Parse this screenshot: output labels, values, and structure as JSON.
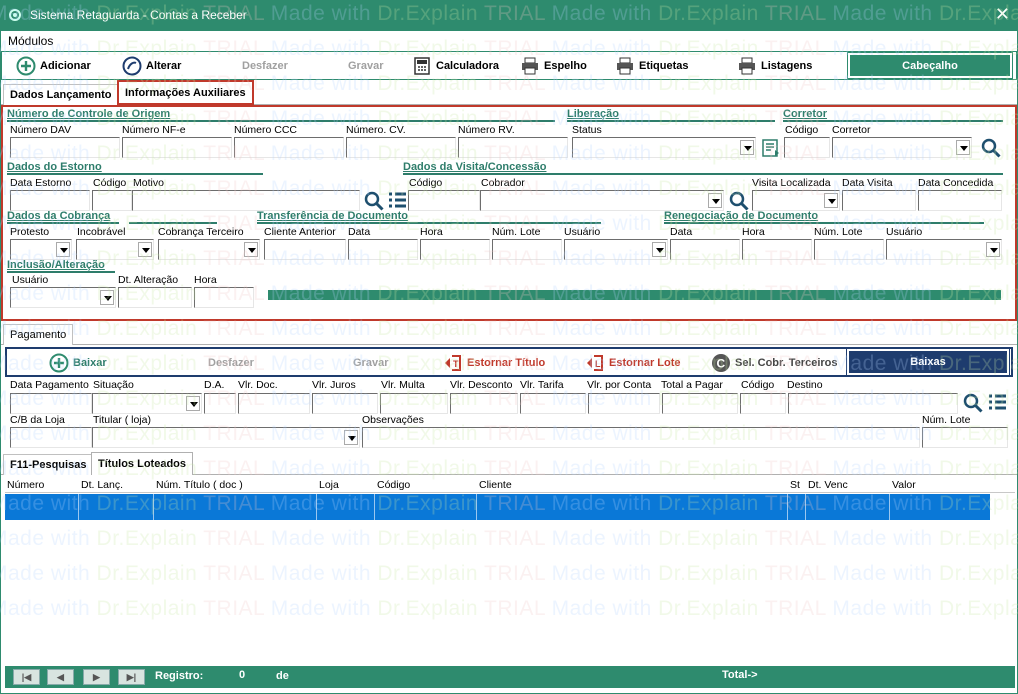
{
  "window": {
    "title": "Sistema Retaguarda - Contas a Receber",
    "close_glyph": "✕"
  },
  "menu": {
    "items": [
      "Módulos"
    ]
  },
  "toolbar1": {
    "adicionar": "Adicionar",
    "alterar": "Alterar",
    "desfazer": "Desfazer",
    "gravar": "Gravar",
    "calculadora": "Calculadora",
    "espelho": "Espelho",
    "etiquetas": "Etiquetas",
    "listagens": "Listagens",
    "cabecalho": "Cabeçalho"
  },
  "tabs_top": {
    "dados": "Dados Lançamento",
    "info": "Informações Auxiliares"
  },
  "sections": {
    "controle": "Número de Controle de Origem",
    "liberacao": "Liberação",
    "corretor": "Corretor",
    "estorno": "Dados do Estorno",
    "visita": "Dados da Visita/Concessão",
    "cobranca": "Dados da Cobrança",
    "transferencia": "Transferência de Documento",
    "renegociacao": "Renegociação de Documento",
    "inclusao": "Inclusão/Alteração"
  },
  "labels": {
    "numero_dav": "Número DAV",
    "numero_nfe": "Número NF-e",
    "numero_ccc": "Número CCC",
    "numero_cv": "Número. CV.",
    "numero_rv": "Número RV.",
    "status": "Status",
    "codigo": "Código",
    "corretor": "Corretor",
    "data_estorno": "Data Estorno",
    "motivo": "Motivo",
    "cobrador": "Cobrador",
    "visita_localizada": "Visita Localizada",
    "data_visita": "Data Visita",
    "data_concedida": "Data Concedida",
    "protesto": "Protesto",
    "incobravel": "Incobrável",
    "cobranca_terceiro": "Cobrança Terceiro",
    "cliente_anterior": "Cliente Anterior",
    "data": "Data",
    "hora": "Hora",
    "num_lote": "Núm. Lote",
    "usuario": "Usuário",
    "dt_alteracao": "Dt. Alteração"
  },
  "pagamento_tab": "Pagamento",
  "toolbar2": {
    "baixar": "Baixar",
    "desfazer": "Desfazer",
    "gravar": "Gravar",
    "estornar_titulo": "Estornar Título",
    "estornar_lote": "Estornar Lote",
    "sel_cobr": "Sel. Cobr. Terceiros",
    "baixas": "Baixas"
  },
  "pag_labels": {
    "data_pagamento": "Data Pagamento",
    "situacao": "Situação",
    "da": "D.A.",
    "vlr_doc": "Vlr. Doc.",
    "vlr_juros": "Vlr. Juros",
    "vlr_multa": "Vlr. Multa",
    "vlr_desconto": "Vlr. Desconto",
    "vlr_tarifa": "Vlr. Tarifa",
    "vlr_por_conta": "Vlr. por Conta",
    "total_a_pagar": "Total a Pagar",
    "codigo": "Código",
    "destino": "Destino",
    "cb_loja": "C/B da Loja",
    "titular": "Titular ( loja)",
    "observacoes": "Observações",
    "num_lote": "Núm. Lote"
  },
  "tabs_bottom": {
    "f11": "F11-Pesquisas",
    "titulos": "Títulos Loteados"
  },
  "grid": {
    "columns": [
      "Número",
      "Dt. Lanç.",
      "Núm. Título ( doc )",
      "Loja",
      "Código",
      "Cliente",
      "St",
      "Dt. Venc",
      "Valor"
    ]
  },
  "status": {
    "registro_label": "Registro:",
    "registro_value": "0",
    "de": "de",
    "total": "Total->"
  },
  "watermark": {
    "part1": "Made with ",
    "part2": "Dr.Explain ",
    "part3": "TRIAL"
  },
  "colors": {
    "teal": "#2e8b6e",
    "highlight": "#c0392b",
    "navy": "#1e3c6e",
    "row": "#0a78d7"
  }
}
